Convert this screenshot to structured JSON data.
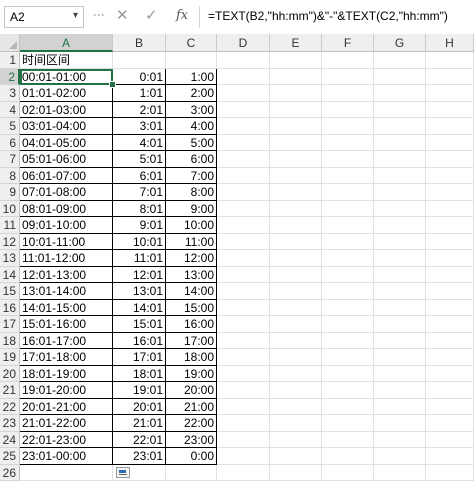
{
  "formula_bar": {
    "name_box": "A2",
    "name_box_arrow": "▾",
    "cancel_glyph": "✕",
    "enter_glyph": "✓",
    "function_glyph": "fx",
    "formula": "=TEXT(B2,\"hh:mm\")&\"-\"&TEXT(C2,\"hh:mm\")"
  },
  "columns": [
    "A",
    "B",
    "C",
    "D",
    "E",
    "F",
    "G",
    "H"
  ],
  "active_cell": "A2",
  "rows": [
    {
      "n": "1",
      "a": "时间区间",
      "b": "",
      "c": ""
    },
    {
      "n": "2",
      "a": "00:01-01:00",
      "b": "0:01",
      "c": "1:00"
    },
    {
      "n": "3",
      "a": "01:01-02:00",
      "b": "1:01",
      "c": "2:00"
    },
    {
      "n": "4",
      "a": "02:01-03:00",
      "b": "2:01",
      "c": "3:00"
    },
    {
      "n": "5",
      "a": "03:01-04:00",
      "b": "3:01",
      "c": "4:00"
    },
    {
      "n": "6",
      "a": "04:01-05:00",
      "b": "4:01",
      "c": "5:00"
    },
    {
      "n": "7",
      "a": "05:01-06:00",
      "b": "5:01",
      "c": "6:00"
    },
    {
      "n": "8",
      "a": "06:01-07:00",
      "b": "6:01",
      "c": "7:00"
    },
    {
      "n": "9",
      "a": "07:01-08:00",
      "b": "7:01",
      "c": "8:00"
    },
    {
      "n": "10",
      "a": "08:01-09:00",
      "b": "8:01",
      "c": "9:00"
    },
    {
      "n": "11",
      "a": "09:01-10:00",
      "b": "9:01",
      "c": "10:00"
    },
    {
      "n": "12",
      "a": "10:01-11:00",
      "b": "10:01",
      "c": "11:00"
    },
    {
      "n": "13",
      "a": "11:01-12:00",
      "b": "11:01",
      "c": "12:00"
    },
    {
      "n": "14",
      "a": "12:01-13:00",
      "b": "12:01",
      "c": "13:00"
    },
    {
      "n": "15",
      "a": "13:01-14:00",
      "b": "13:01",
      "c": "14:00"
    },
    {
      "n": "16",
      "a": "14:01-15:00",
      "b": "14:01",
      "c": "15:00"
    },
    {
      "n": "17",
      "a": "15:01-16:00",
      "b": "15:01",
      "c": "16:00"
    },
    {
      "n": "18",
      "a": "16:01-17:00",
      "b": "16:01",
      "c": "17:00"
    },
    {
      "n": "19",
      "a": "17:01-18:00",
      "b": "17:01",
      "c": "18:00"
    },
    {
      "n": "20",
      "a": "18:01-19:00",
      "b": "18:01",
      "c": "19:00"
    },
    {
      "n": "21",
      "a": "19:01-20:00",
      "b": "19:01",
      "c": "20:00"
    },
    {
      "n": "22",
      "a": "20:01-21:00",
      "b": "20:01",
      "c": "21:00"
    },
    {
      "n": "23",
      "a": "21:01-22:00",
      "b": "21:01",
      "c": "22:00"
    },
    {
      "n": "24",
      "a": "22:01-23:00",
      "b": "22:01",
      "c": "23:00"
    },
    {
      "n": "25",
      "a": "23:01-00:00",
      "b": "23:01",
      "c": "0:00"
    },
    {
      "n": "26",
      "a": "",
      "b": "",
      "c": ""
    }
  ]
}
